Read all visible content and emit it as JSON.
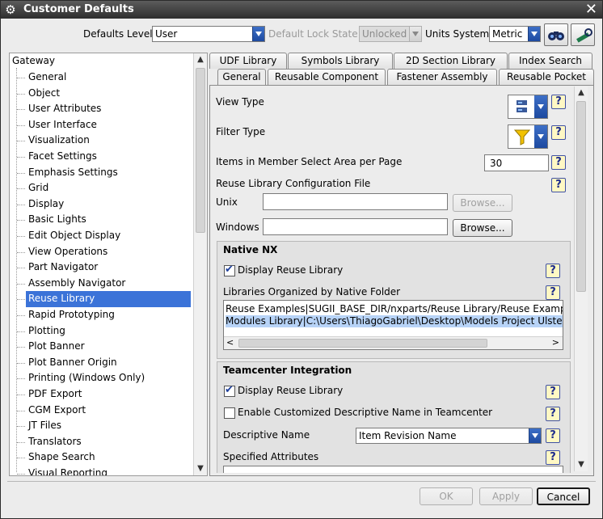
{
  "window": {
    "title": "Customer Defaults"
  },
  "toolbar": {
    "defaults_level_label": "Defaults Level",
    "defaults_level_value": "User",
    "lock_state_label": "Default Lock State",
    "lock_state_value": "Unlocked",
    "units_label": "Units System",
    "units_value": "Metric",
    "find_icon": "binoculars-icon",
    "manage_icon": "wrench-icon"
  },
  "tree": {
    "root": "Gateway",
    "items": [
      "General",
      "Object",
      "User Attributes",
      "User Interface",
      "Visualization",
      "Facet Settings",
      "Emphasis Settings",
      "Grid",
      "Display",
      "Basic Lights",
      "Edit Object Display",
      "View Operations",
      "Part Navigator",
      "Assembly Navigator",
      "Reuse Library",
      "Rapid Prototyping",
      "Plotting",
      "Plot Banner",
      "Plot Banner Origin",
      "Printing (Windows Only)",
      "PDF Export",
      "CGM Export",
      "JT Files",
      "Translators",
      "Shape Search",
      "Visual Reporting"
    ],
    "selected": "Reuse Library"
  },
  "tabs": {
    "row1": [
      "UDF Library",
      "Symbols Library",
      "2D Section Library",
      "Index Search"
    ],
    "row2": [
      "General",
      "Reusable Component",
      "Fastener Assembly",
      "Reusable Pocket"
    ],
    "active": "General"
  },
  "general": {
    "view_type_label": "View Type",
    "filter_type_label": "Filter Type",
    "items_per_page_label": "Items in Member Select Area per Page",
    "items_per_page_value": "30",
    "config_file_label": "Reuse Library Configuration File",
    "unix_label": "Unix",
    "unix_value": "",
    "windows_label": "Windows",
    "windows_value": "",
    "browse_label": "Browse...",
    "help_label": "?"
  },
  "native_nx": {
    "title": "Native NX",
    "display_label": "Display Reuse Library",
    "display_checked": true,
    "libs_label": "Libraries Organized by Native Folder",
    "libraries": [
      "Reuse Examples|SUGII_BASE_DIR/nxparts/Reuse Library/Reuse Examples",
      "Modules Library|C:\\Users\\ThiagoGabriel\\Desktop\\Models Project Ulstein"
    ]
  },
  "teamcenter": {
    "title": "Teamcenter Integration",
    "display_label": "Display Reuse Library",
    "display_checked": true,
    "custom_name_label": "Enable Customized Descriptive Name in Teamcenter",
    "custom_name_checked": false,
    "desc_name_label": "Descriptive Name",
    "desc_name_value": "Item Revision Name",
    "specified_attrs_label": "Specified Attributes"
  },
  "buttons": {
    "ok": "OK",
    "apply": "Apply",
    "cancel": "Cancel"
  }
}
